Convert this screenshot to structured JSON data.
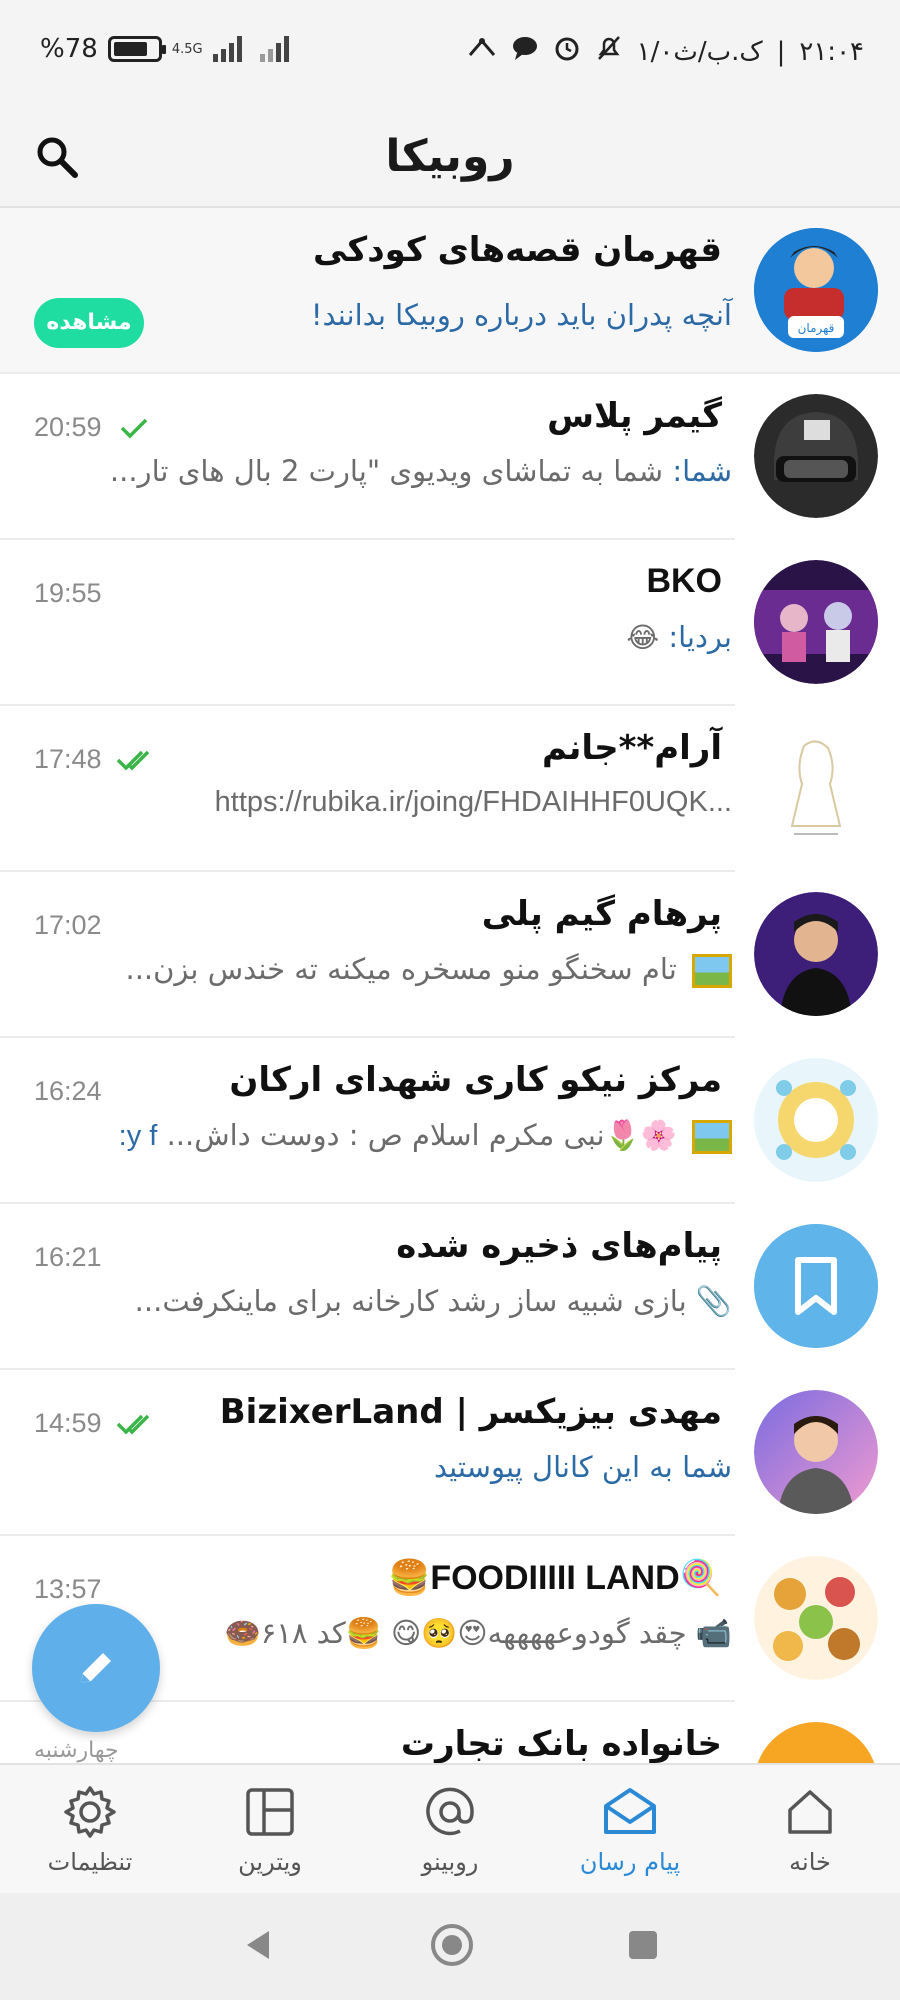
{
  "status_bar": {
    "time": "۲۱:۰۴",
    "date": "۱/۰ک.ب/ث",
    "battery": "78",
    "battery_suffix": "%",
    "network": "4.5G",
    "battery_level": 0.78
  },
  "app_bar": {
    "title": "روبیکا",
    "search_icon": "search-icon"
  },
  "colors": {
    "accent": "#2b8ad6",
    "link_blue": "#2c6aa6",
    "check_green": "#3bb54a",
    "view_button": "#1fdca0",
    "fab": "#5fb0ea"
  },
  "ad": {
    "title": "قهرمان قصه‌های کودکی",
    "description": "آنچه پدران باید درباره روبیکا بدانند!",
    "button": "مشاهده"
  },
  "chats": [
    {
      "title": "گیمر پلاس",
      "sender": "شما:",
      "preview": "شما به تماشای ویدیوی \"پارت 2 بال های تار...",
      "time": "20:59",
      "ticks": "single"
    },
    {
      "title": "BKO",
      "sender": "بردیا:",
      "preview": "😂",
      "time": "19:55",
      "ticks": "none"
    },
    {
      "title": "آرام**جانم",
      "sender": "",
      "preview": "https://rubika.ir/joing/FHDAIHHF0UQK...",
      "time": "17:48",
      "ticks": "double"
    },
    {
      "title": "پرهام گیم پلی",
      "sender": "",
      "preview": "تام سخنگو منو مسخره میکنه ته خندس بزن...",
      "time": "17:02",
      "ticks": "none"
    },
    {
      "title": "مرکز نیکو کاری شهدای ارکان",
      "sender": "",
      "preview": "🌸🌷نبی مکرم اسلام ص :  دوست داش...",
      "sender_end": "y f:",
      "time": "16:24",
      "ticks": "none"
    },
    {
      "title": "پیام‌های ذخیره شده",
      "sender": "",
      "preview": "📎 بازی شبیه ساز رشد کارخانه برای ماینکرفت...",
      "time": "16:21",
      "ticks": "none"
    },
    {
      "title": "مهدی بیزیکسر | BizixerLand",
      "sender": "",
      "preview": "شما به این کانال پیوستید",
      "time": "14:59",
      "ticks": "double"
    },
    {
      "title": "🍭FOODIIIII LAND🍔",
      "sender": "",
      "preview": "📹 چقد گودوعههههه😍🥺😋  🍔کد ۶۱۸🍩",
      "time": "13:57",
      "ticks": "none"
    },
    {
      "title": "خانواده بانک تجارت",
      "sender": "",
      "preview": "",
      "time": "چهارشنبه",
      "ticks": "none"
    }
  ],
  "nav": {
    "settings": "تنظیمات",
    "showcase": "ویترین",
    "rubino": "روبینو",
    "messenger": "پیام رسان",
    "home": "خانه"
  }
}
